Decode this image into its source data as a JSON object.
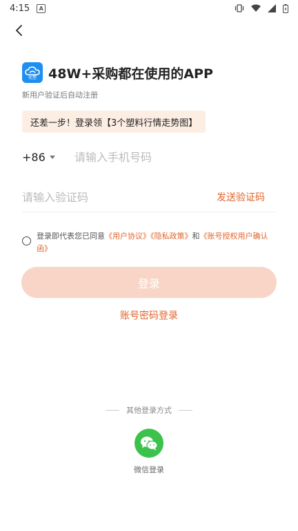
{
  "status_bar": {
    "time": "4:15"
  },
  "logo": {
    "label": "化塑"
  },
  "header": {
    "title": "48W+采购都在使用的APP",
    "subtitle": "新用户验证后自动注册"
  },
  "promo": {
    "text": "还差一步！登录领【3个塑料行情走势图】"
  },
  "phone": {
    "country_code": "+86",
    "placeholder": "请输入手机号码"
  },
  "code": {
    "placeholder": "请输入验证码",
    "send_label": "发送验证码"
  },
  "agreement": {
    "prefix": "登录即代表您已同意",
    "user_agreement": "《用户协议》",
    "privacy_policy": "《隐私政策》",
    "and": "和",
    "account_auth": "《账号授权用户确认函》"
  },
  "login": {
    "button_label": "登录",
    "password_login_label": "账号密码登录"
  },
  "other_login": {
    "label": "其他登录方式",
    "wechat_label": "微信登录"
  },
  "colors": {
    "accent": "#e0652d",
    "login_button_disabled": "#f8d5c7",
    "promo_background": "#fdeee4",
    "wechat_green": "#3cc24c",
    "logo_blue": "#1e8ff0"
  }
}
